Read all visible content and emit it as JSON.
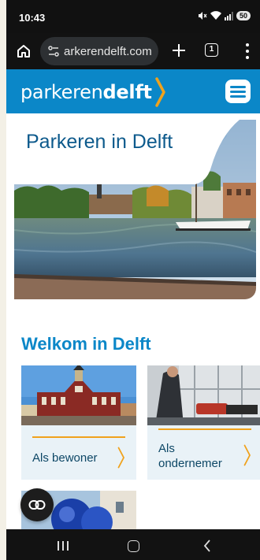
{
  "status_bar": {
    "time": "10:43",
    "battery": "50"
  },
  "browser": {
    "url_display": "arkerendelft.com",
    "tab_count": "1"
  },
  "site": {
    "logo_thin": "parkeren",
    "logo_bold": "delft",
    "brand_color": "#0b87c8",
    "accent_color": "#f0a21c"
  },
  "hero": {
    "title": "Parkeren in Delft"
  },
  "welcome": {
    "title": "Welkom in Delft",
    "cards": [
      {
        "label": "Als bewoner"
      },
      {
        "label_line1": "Als",
        "label_line2": "ondernemer"
      }
    ]
  },
  "icons": {
    "home": "home-icon",
    "site_info": "tune-icon",
    "new_tab": "plus-icon",
    "tabs": "tab-switcher-icon",
    "menu": "more-vert-icon",
    "hamburger": "menu-icon",
    "fab": "link-icon",
    "nav_recent": "recent-apps-icon",
    "nav_home": "android-home-icon",
    "nav_back": "back-icon"
  }
}
